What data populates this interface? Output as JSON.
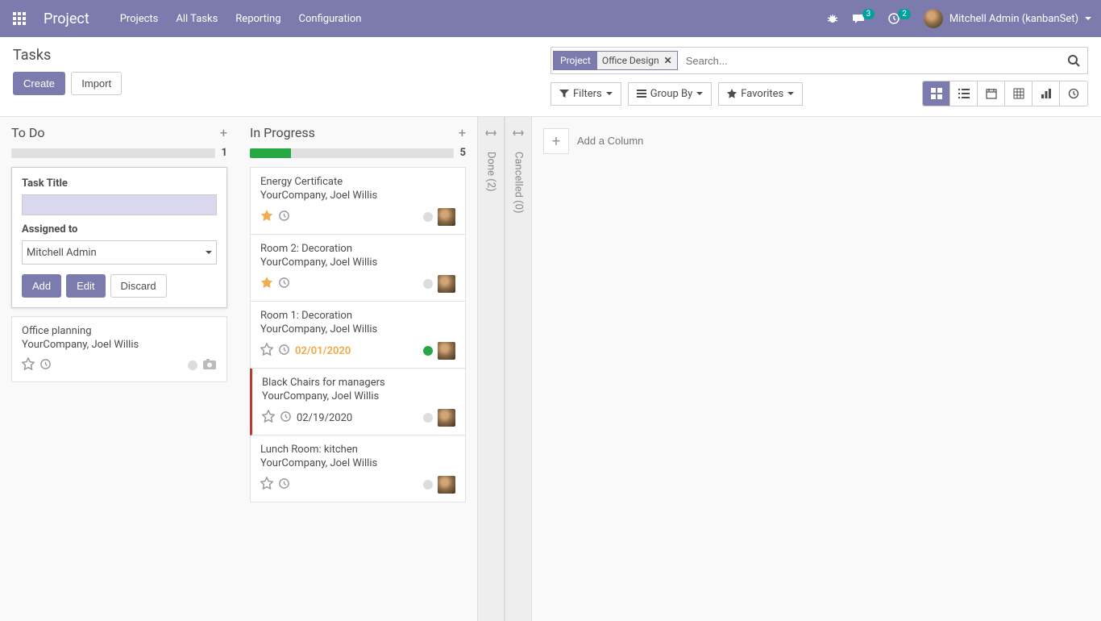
{
  "header": {
    "brand": "Project",
    "nav": [
      "Projects",
      "All Tasks",
      "Reporting",
      "Configuration"
    ],
    "msg_badge": "3",
    "clock_badge": "2",
    "user": "Mitchell Admin (kanbanSet)"
  },
  "page": {
    "title": "Tasks",
    "create": "Create",
    "import": "Import"
  },
  "search": {
    "facet": "Project",
    "value": "Office Design",
    "placeholder": "Search..."
  },
  "filters": {
    "filters": "Filters",
    "groupby": "Group By",
    "favorites": "Favorites"
  },
  "columns": {
    "todo": {
      "title": "To Do",
      "count": "1",
      "progress": 0
    },
    "inprogress": {
      "title": "In Progress",
      "count": "5",
      "progress": 20
    },
    "done": "Done (2)",
    "cancelled": "Cancelled (0)"
  },
  "quick_create": {
    "title_label": "Task Title",
    "assigned_label": "Assigned to",
    "assigned_value": "Mitchell Admin",
    "add": "Add",
    "edit": "Edit",
    "discard": "Discard"
  },
  "todo_tasks": [
    {
      "title": "Office planning",
      "sub": "YourCompany, Joel Willis",
      "starred": false,
      "date": "",
      "status": "grey",
      "avatar": false
    }
  ],
  "inprogress_tasks": [
    {
      "title": "Energy Certificate",
      "sub": "YourCompany, Joel Willis",
      "starred": true,
      "date": "",
      "status": "grey",
      "avatar": true,
      "red": false
    },
    {
      "title": "Room 2: Decoration",
      "sub": "YourCompany, Joel Willis",
      "starred": true,
      "date": "",
      "status": "grey",
      "avatar": true,
      "red": false
    },
    {
      "title": "Room 1: Decoration",
      "sub": "YourCompany, Joel Willis",
      "starred": false,
      "date": "02/01/2020",
      "date_warn": true,
      "status": "green",
      "avatar": true,
      "red": false
    },
    {
      "title": "Black Chairs for managers",
      "sub": "YourCompany, Joel Willis",
      "starred": false,
      "date": "02/19/2020",
      "date_warn": false,
      "status": "grey",
      "avatar": true,
      "red": true
    },
    {
      "title": "Lunch Room: kitchen",
      "sub": "YourCompany, Joel Willis",
      "starred": false,
      "date": "",
      "status": "grey",
      "avatar": true,
      "red": false
    }
  ],
  "add_column": "Add a Column"
}
